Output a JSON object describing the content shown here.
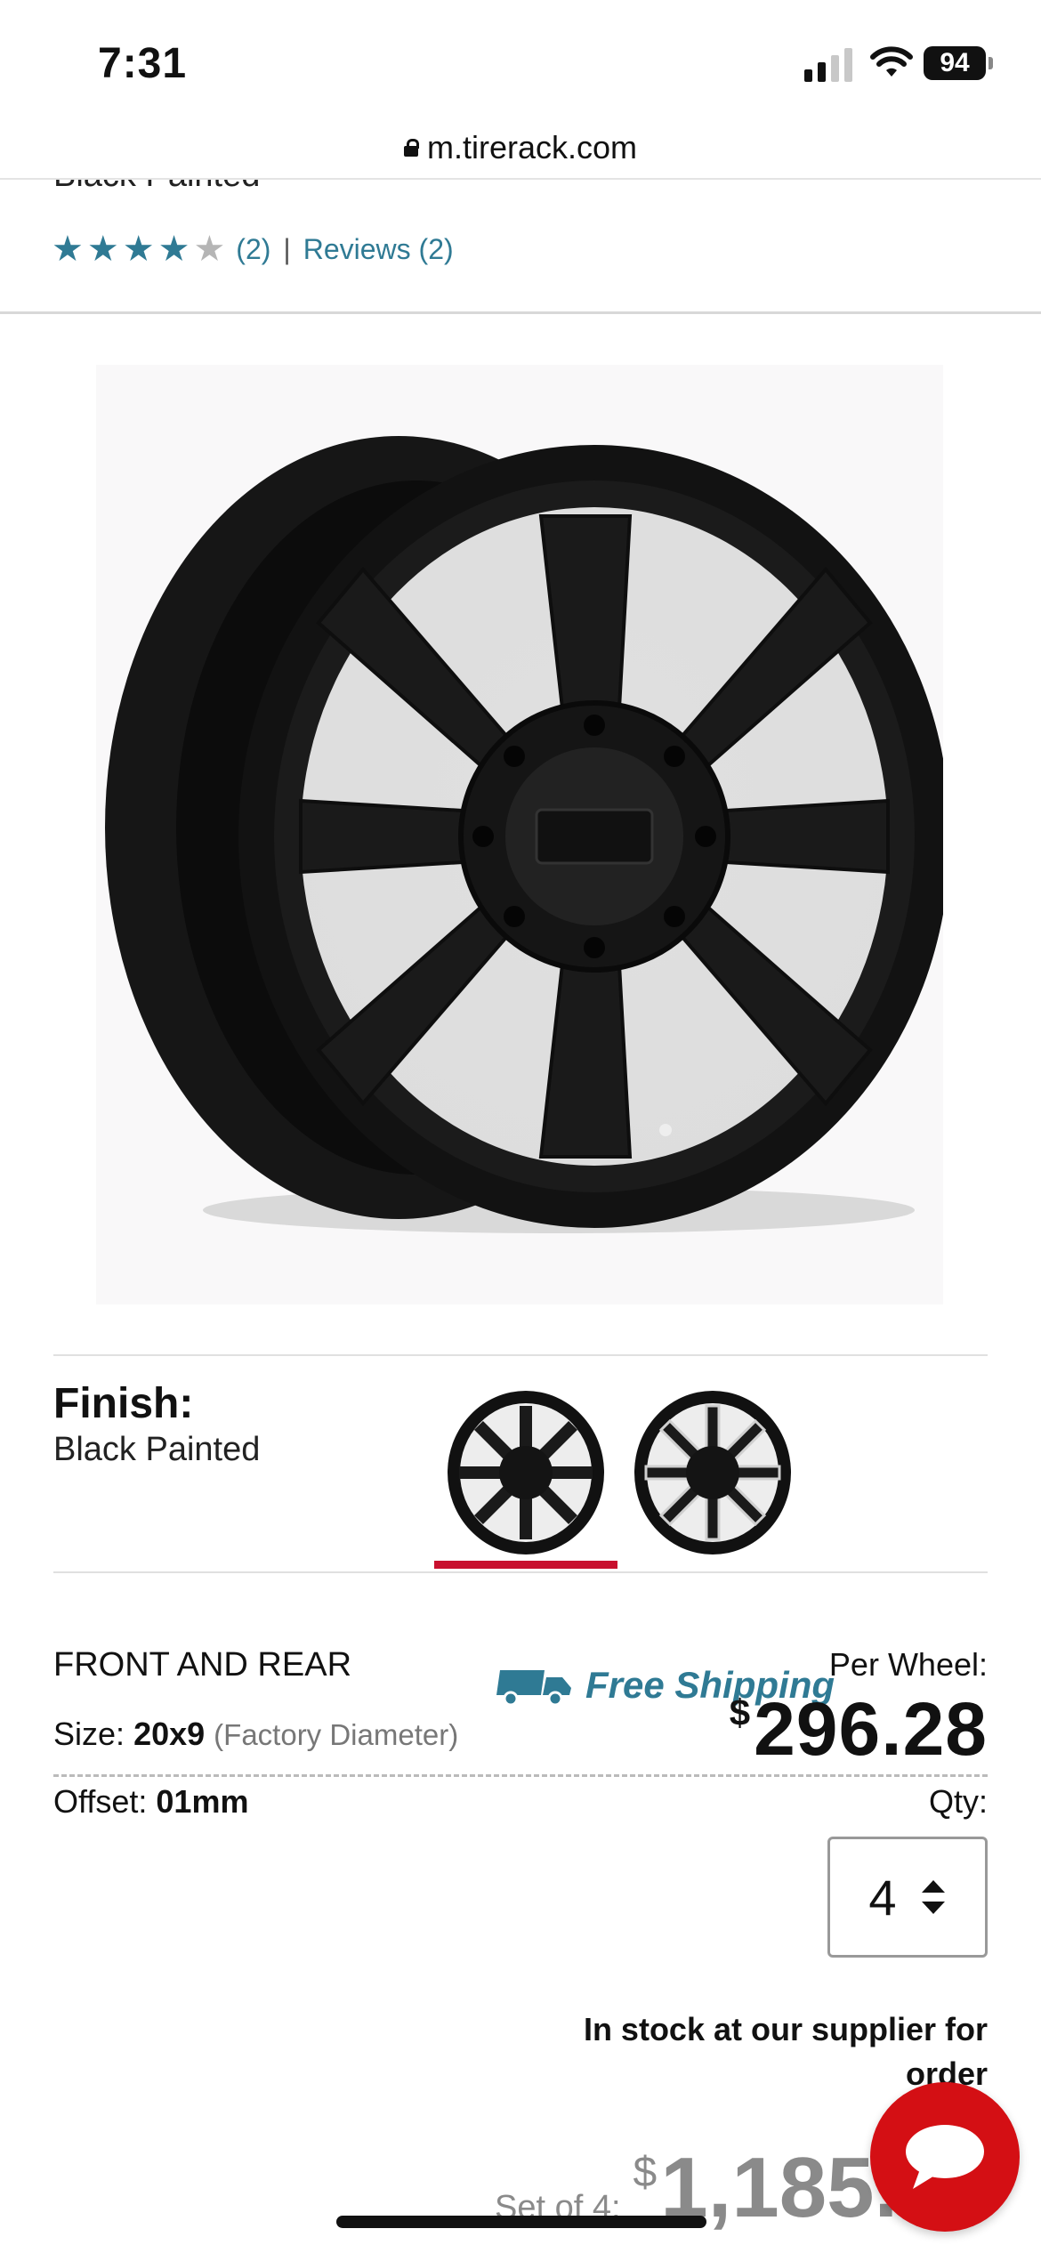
{
  "status_bar": {
    "time": "7:31",
    "battery": "94"
  },
  "browser": {
    "url": "m.tirerack.com"
  },
  "product": {
    "title_partial": "Black Painted",
    "rating_stars": 4,
    "rating_max": 5,
    "rating_count": "(2)",
    "separator": "|",
    "reviews_link": "Reviews (2)"
  },
  "finish": {
    "label": "Finish:",
    "value": "Black Painted",
    "options": [
      "black-painted",
      "black-machined"
    ],
    "selected": 0
  },
  "details": {
    "position": "FRONT AND REAR",
    "size_label": "Size:",
    "size_value": "20x9",
    "size_note": "(Factory Diameter)",
    "offset_label": "Offset:",
    "offset_value": "01mm"
  },
  "pricing": {
    "free_shipping": "Free Shipping",
    "per_wheel_label": "Per Wheel:",
    "currency": "$",
    "per_wheel_price": "296.28",
    "qty_label": "Qty:",
    "qty_value": "4",
    "stock_line1": "In stock at our supplier for",
    "stock_line2": "order",
    "set_label": "Set of 4:",
    "set_price": "1,185."
  },
  "colors": {
    "accent": "#2f7a94",
    "brand_red": "#d40f14",
    "tab_red": "#c8102e"
  },
  "icons": [
    "lock-icon",
    "star-icon",
    "truck-icon",
    "updown-icon",
    "chat-icon",
    "wifi-icon",
    "signal-icon"
  ]
}
